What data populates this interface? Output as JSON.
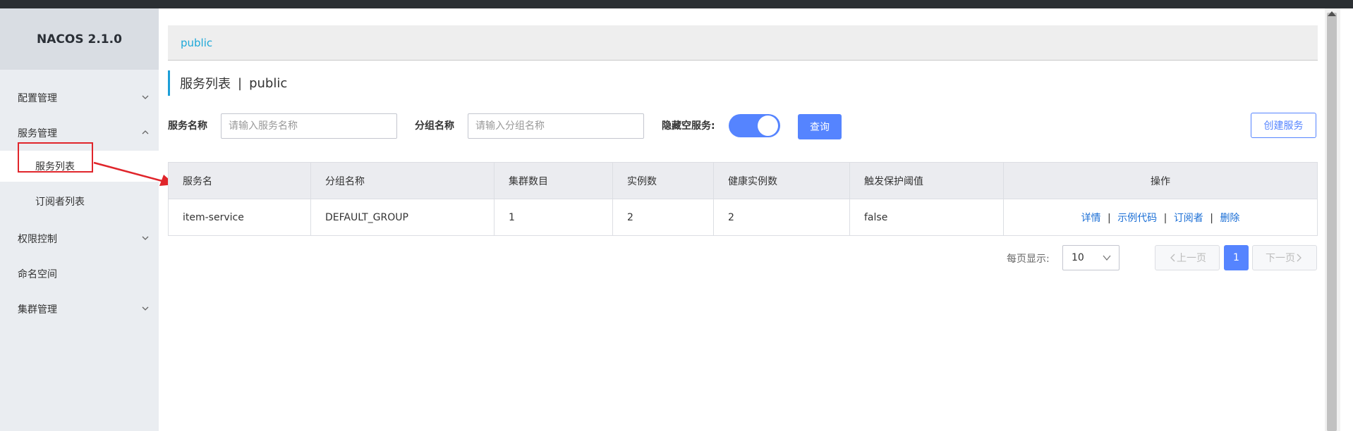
{
  "app": {
    "title": "NACOS 2.1.0"
  },
  "sidebar": {
    "items": [
      {
        "label": "配置管理",
        "has_chevron": true,
        "expanded": false
      },
      {
        "label": "服务管理",
        "has_chevron": true,
        "expanded": true
      },
      {
        "label": "权限控制",
        "has_chevron": true,
        "expanded": false
      },
      {
        "label": "命名空间",
        "has_chevron": false
      },
      {
        "label": "集群管理",
        "has_chevron": true,
        "expanded": false
      }
    ],
    "sub_items": [
      {
        "label": "服务列表",
        "active": true
      },
      {
        "label": "订阅者列表",
        "active": false
      }
    ]
  },
  "breadcrumb": {
    "namespace": "public"
  },
  "page": {
    "title": "服务列表",
    "separator": "|",
    "namespace": "public"
  },
  "filters": {
    "service_name_label": "服务名称",
    "service_name_placeholder": "请输入服务名称",
    "group_name_label": "分组名称",
    "group_name_placeholder": "请输入分组名称",
    "hide_empty_label": "隐藏空服务:",
    "hide_empty_on": true,
    "query_label": "查询",
    "create_label": "创建服务"
  },
  "table": {
    "headers": [
      "服务名",
      "分组名称",
      "集群数目",
      "实例数",
      "健康实例数",
      "触发保护阈值",
      "操作"
    ],
    "rows": [
      {
        "name": "item-service",
        "group": "DEFAULT_GROUP",
        "clusters": "1",
        "instances": "2",
        "healthy": "2",
        "threshold": "false"
      }
    ],
    "actions": [
      "详情",
      "示例代码",
      "订阅者",
      "删除"
    ],
    "action_separator": "|"
  },
  "pagination": {
    "page_size_label": "每页显示:",
    "page_size": "10",
    "prev_label": "上一页",
    "next_label": "下一页",
    "current_page": "1"
  },
  "colors": {
    "accent": "#5584ff",
    "link": "#1a6ed5",
    "annotation": "#e0252b"
  }
}
